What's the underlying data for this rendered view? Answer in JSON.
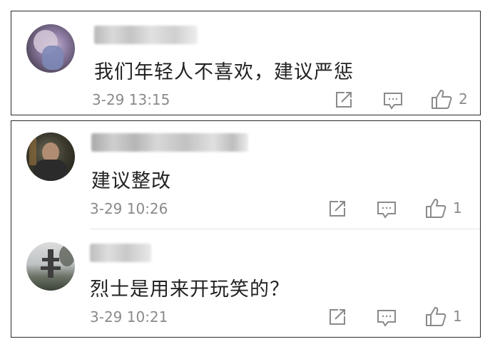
{
  "comments_top": [
    {
      "text": "我们年轻人不喜欢，建议严惩",
      "time": "3-29 13:15",
      "likes": "2",
      "username_blurred": true
    }
  ],
  "comments_bottom": [
    {
      "text": "建议整改",
      "time": "3-29 10:26",
      "likes": "1",
      "username_blurred": true
    },
    {
      "text": "烈士是用来开玩笑的？",
      "time": "3-29 10:21",
      "likes": "1",
      "username_blurred": true
    }
  ],
  "icons": {
    "share": "share-icon",
    "reply": "comment-icon",
    "like": "thumbs-up-icon"
  },
  "colors": {
    "text": "#222222",
    "meta": "#8a8a8a",
    "icon": "#8a8a8a",
    "border": "#2a2a2a"
  }
}
